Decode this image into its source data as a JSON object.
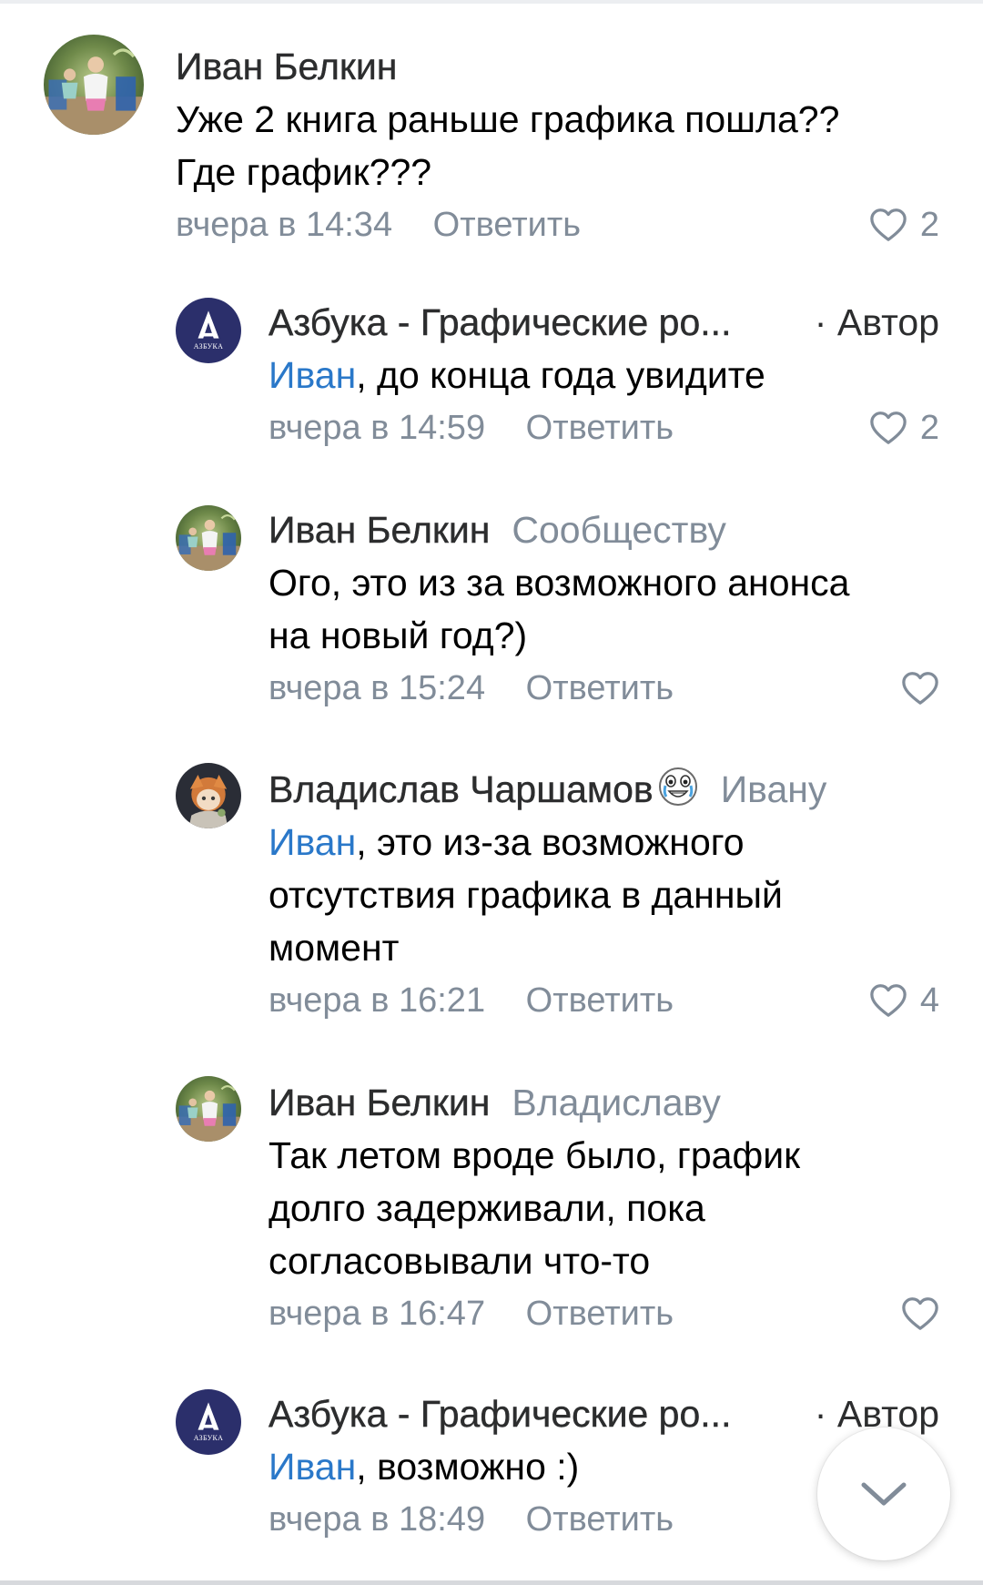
{
  "colors": {
    "meta_gray": "#818c99",
    "mention_blue": "#2a78c9",
    "text_black": "#000000",
    "azbuka_navy": "#2b2f6b"
  },
  "comments": [
    {
      "author": "Иван Белкин",
      "reply_to": "",
      "badge": "",
      "mention": "",
      "text": "Уже 2 книга раньше графика пошла??\nГде график???",
      "time": "вчера в 14:34",
      "reply_label": "Ответить",
      "likes": "2",
      "avatar": "photo-avatar-ivan"
    },
    {
      "author": "Азбука - Графические ро...",
      "reply_to": "",
      "badge": "· Автор",
      "mention": "Иван",
      "text": ", до конца года увидите",
      "time": "вчера в 14:59",
      "reply_label": "Ответить",
      "likes": "2",
      "avatar": "azbuka-logo"
    },
    {
      "author": "Иван Белкин",
      "reply_to": "Сообществу",
      "badge": "",
      "mention": "",
      "text": "Ого, это из за возможного анонса\nна новый год?)",
      "time": "вчера в 15:24",
      "reply_label": "Ответить",
      "likes": "",
      "avatar": "photo-avatar-ivan"
    },
    {
      "author": "Владислав Чаршамов",
      "reply_to": "Ивану",
      "badge": "",
      "mention": "Иван",
      "text": ", это из-за возможного\nотсутствия графика в данный\nмомент",
      "time": "вчера в 16:21",
      "reply_label": "Ответить",
      "likes": "4",
      "avatar": "anime-avatar-vladislav",
      "name_emoji": "crying-laughing-face-icon"
    },
    {
      "author": "Иван Белкин",
      "reply_to": "Владиславу",
      "badge": "",
      "mention": "",
      "text": "Так летом вроде было, график\nдолго задерживали, пока\nсогласовывали что-то",
      "time": "вчера в 16:47",
      "reply_label": "Ответить",
      "likes": "",
      "avatar": "photo-avatar-ivan"
    },
    {
      "author": "Азбука - Графические ро...",
      "reply_to": "",
      "badge": "· Автор",
      "mention": "Иван",
      "text": ", возможно :)",
      "time": "вчера в 18:49",
      "reply_label": "Ответить",
      "likes": "",
      "avatar": "azbuka-logo"
    }
  ],
  "logo_text": "АЗБУКА",
  "scroll_button_icon": "chevron-down-icon"
}
